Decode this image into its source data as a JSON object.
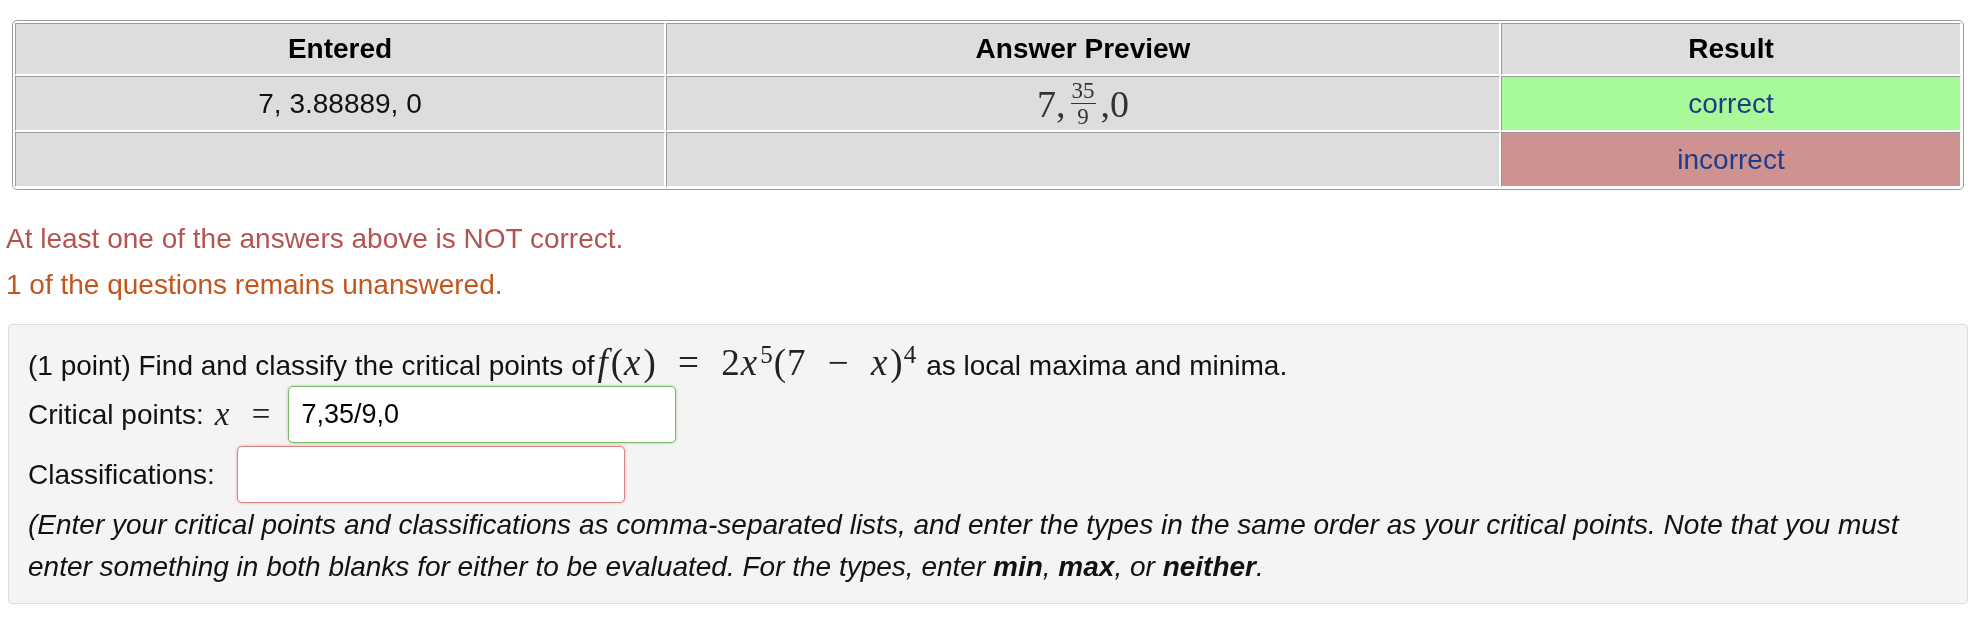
{
  "results_table": {
    "columns": [
      "Entered",
      "Answer Preview",
      "Result"
    ],
    "rows": [
      {
        "entered": "7, 3.88889, 0",
        "preview": [
          {
            "kind": "text",
            "text": "7,"
          },
          {
            "kind": "fraction",
            "numerator": "35",
            "denominator": "9"
          },
          {
            "kind": "text",
            "text": ",0"
          }
        ],
        "result": "correct",
        "correct": true
      },
      {
        "result": "incorrect",
        "correct": false
      }
    ]
  },
  "messages": [
    {
      "kind": "error",
      "text": "At least one of the answers above is NOT correct."
    },
    {
      "kind": "warning",
      "text": "1 of the questions remains unanswered."
    }
  ],
  "problem": {
    "statement": "(1 point) Find and classify the critical points of",
    "formula": [
      {
        "kind": "var",
        "text": "f"
      },
      {
        "kind": "text",
        "text": "("
      },
      {
        "kind": "var",
        "text": "x"
      },
      {
        "kind": "text",
        "text": ") = 2"
      },
      {
        "kind": "var",
        "text": "x"
      },
      {
        "kind": "sup",
        "text": "5"
      },
      {
        "kind": "text",
        "text": "(7 − "
      },
      {
        "kind": "var",
        "text": "x"
      },
      {
        "kind": "text",
        "text": ")"
      },
      {
        "kind": "sup",
        "text": "4"
      }
    ],
    "statement_end": "as local maxima and minima.",
    "fields": [
      {
        "label": "Critical points:",
        "math_label": "*x* =",
        "value": "7,35/9,0",
        "correct": true
      },
      {
        "label": "Classifications:",
        "correct": false
      }
    ],
    "instructions": "(Enter your critical points and classifications as comma-separated lists, and enter the types in the same order as your critical points. Note that you must enter something in both blanks for either to be evaluated. For the types, enter **min**, **max**, or **neither**."
  }
}
